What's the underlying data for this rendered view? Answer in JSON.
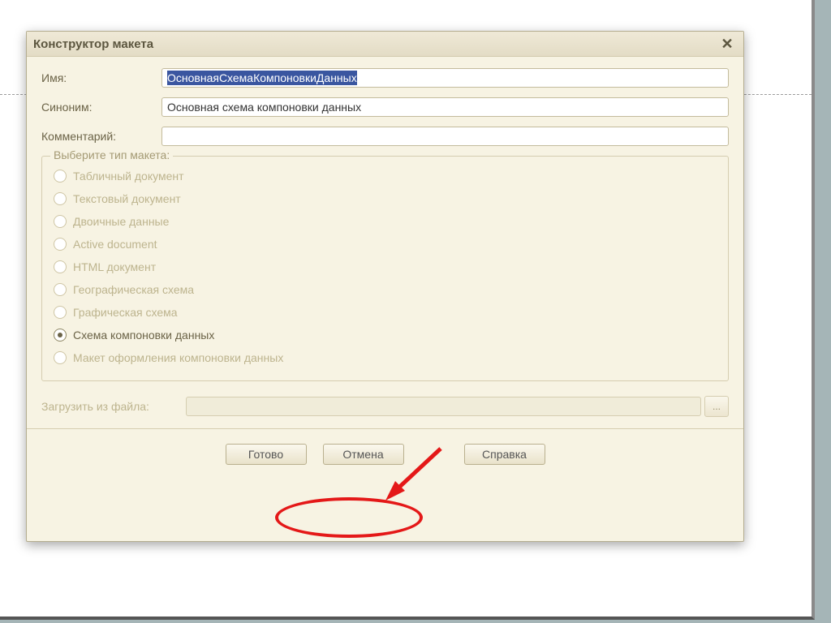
{
  "dialog": {
    "title": "Конструктор макета",
    "fields": {
      "name_label": "Имя:",
      "name_value": "ОсновнаяСхемаКомпоновкиДанных",
      "synonym_label": "Синоним:",
      "synonym_value": "Основная схема компоновки данных",
      "comment_label": "Комментарий:",
      "comment_value": ""
    },
    "group": {
      "legend": "Выберите тип макета:",
      "options": [
        {
          "label": "Табличный документ",
          "enabled": false,
          "checked": false
        },
        {
          "label": "Текстовый документ",
          "enabled": false,
          "checked": false
        },
        {
          "label": "Двоичные данные",
          "enabled": false,
          "checked": false
        },
        {
          "label": "Active document",
          "enabled": false,
          "checked": false
        },
        {
          "label": "HTML документ",
          "enabled": false,
          "checked": false
        },
        {
          "label": "Географическая схема",
          "enabled": false,
          "checked": false
        },
        {
          "label": "Графическая схема",
          "enabled": false,
          "checked": false
        },
        {
          "label": "Схема компоновки данных",
          "enabled": true,
          "checked": true
        },
        {
          "label": "Макет оформления компоновки данных",
          "enabled": false,
          "checked": false
        }
      ]
    },
    "load_label": "Загрузить из файла:",
    "load_browse": "...",
    "buttons": {
      "ok": "Готово",
      "cancel": "Отмена",
      "help": "Справка"
    }
  }
}
